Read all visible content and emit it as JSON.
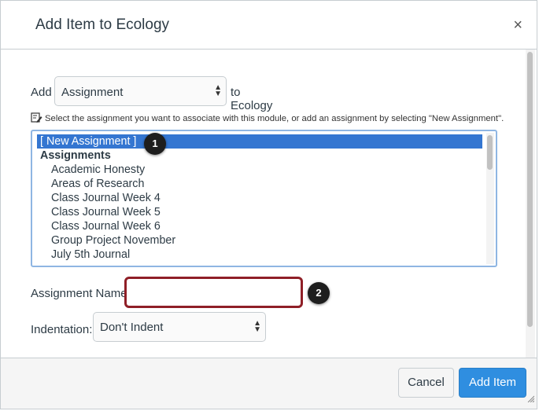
{
  "dialog": {
    "title": "Add Item to Ecology",
    "close_glyph": "×"
  },
  "add_row": {
    "prefix_label": "Add",
    "item_type": "Assignment",
    "suffix_label": "to Ecology"
  },
  "instructions": {
    "icon": "edit-note-icon",
    "text": "Select the assignment you want to associate with this module, or add an assignment by selecting \"New Assignment\"."
  },
  "assignment_list": {
    "selected_option": "[ New Assignment ]",
    "group_label": "Assignments",
    "items": [
      "Academic Honesty",
      "Areas of Research",
      "Class Journal Week 4",
      "Class Journal Week 5",
      "Class Journal Week 6",
      "Group Project November",
      "July 5th Journal"
    ]
  },
  "callouts": [
    "1",
    "2"
  ],
  "assignment_name": {
    "label": "Assignment Name:",
    "value": ""
  },
  "indentation": {
    "label": "Indentation:",
    "value": "Don't Indent"
  },
  "footer": {
    "cancel_label": "Cancel",
    "submit_label": "Add Item"
  },
  "colors": {
    "primary": "#2f8ee0",
    "selection": "#3476d1",
    "highlight_border": "#8f1f27",
    "callout": "#1e1e1e"
  }
}
